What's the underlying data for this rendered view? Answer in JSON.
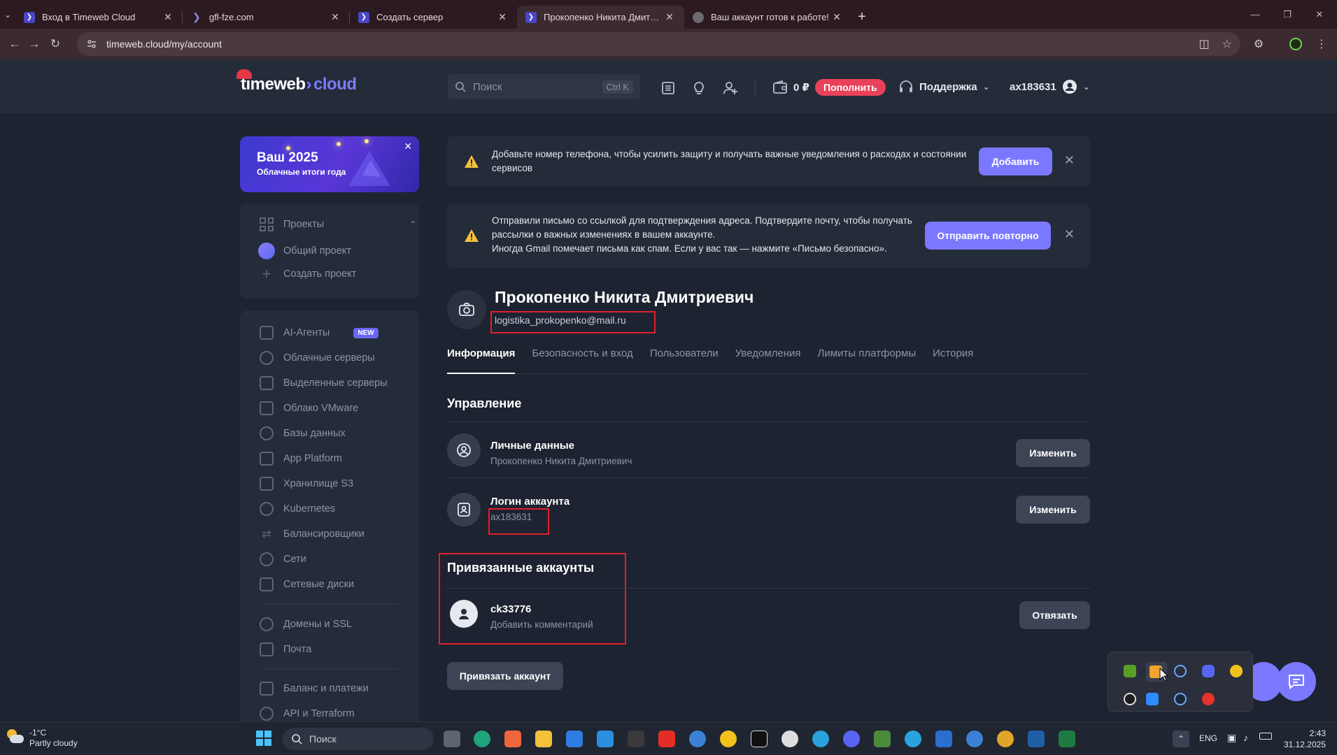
{
  "browser": {
    "tabs": [
      {
        "title": "Вход в Timeweb Cloud",
        "active": false
      },
      {
        "title": "gfl-fze.com",
        "active": false
      },
      {
        "title": "Создать сервер",
        "active": false
      },
      {
        "title": "Прокопенко Никита Дмитриевич",
        "active": true
      },
      {
        "title": "Ваш аккаунт готов к работе!",
        "active": false
      }
    ],
    "url": "timeweb.cloud/my/account"
  },
  "header": {
    "logo_main": "timeweb",
    "logo_accent": "cloud",
    "search_placeholder": "Поиск",
    "search_shortcut": "Ctrl K",
    "balance": "0 ₽",
    "topup_label": "Пополнить",
    "support_label": "Поддержка",
    "account_login": "ax183631"
  },
  "sidebar": {
    "promo_title": "Ваш 2025",
    "promo_subtitle": "Облачные итоги года",
    "projects_title": "Проекты",
    "projects": [
      "Общий проект",
      "Создать проект"
    ],
    "services": [
      {
        "label": "AI-Агенты",
        "badge": "NEW"
      },
      {
        "label": "Облачные серверы"
      },
      {
        "label": "Выделенные серверы"
      },
      {
        "label": "Облако VMware"
      },
      {
        "label": "Базы данных"
      },
      {
        "label": "App Platform"
      },
      {
        "label": "Хранилище S3"
      },
      {
        "label": "Kubernetes"
      },
      {
        "label": "Балансировщики"
      },
      {
        "label": "Сети"
      },
      {
        "label": "Сетевые диски"
      }
    ],
    "extras": [
      "Домены и SSL",
      "Почта"
    ],
    "billing": [
      "Баланс и платежи",
      "API и Terraform"
    ]
  },
  "alerts": [
    {
      "text": "Добавьте номер телефона, чтобы усилить защиту и получать важные уведомления о расходах и состоянии сервисов",
      "button": "Добавить"
    },
    {
      "text_lines": [
        "Отправили письмо со ссылкой для подтверждения адреса. Подтвердите почту, чтобы получать",
        "рассылки о важных изменениях в вашем аккаунте.",
        "Иногда Gmail помечает письма как спам. Если у вас так — нажмите «Письмо безопасно»."
      ],
      "button": "Отправить повторно"
    }
  ],
  "profile": {
    "name": "Прокопенко Никита Дмитриевич",
    "email": "logistika_prokopenko@mail.ru"
  },
  "tabs": [
    "Информация",
    "Безопасность и вход",
    "Пользователи",
    "Уведомления",
    "Лимиты платформы",
    "История"
  ],
  "management": {
    "title": "Управление",
    "rows": [
      {
        "name": "Личные данные",
        "value": "Прокопенко Никита Дмитриевич",
        "button": "Изменить"
      },
      {
        "name": "Логин аккаунта",
        "value": "ax183631",
        "button": "Изменить"
      }
    ]
  },
  "linked": {
    "title": "Привязанные аккаунты",
    "accounts": [
      {
        "name": "ck33776",
        "comment": "Добавить комментарий",
        "button": "Отвязать"
      }
    ],
    "link_button": "Привязать аккаунт"
  },
  "taskbar": {
    "weather_temp": "-1°C",
    "weather_desc": "Partly cloudy",
    "search_placeholder": "Поиск",
    "language": "ENG",
    "time": "2:43",
    "date": "31.12.2025"
  },
  "colors": {
    "accent": "#7b78ff",
    "danger": "#e9415a",
    "highlight_box": "#e0202a"
  }
}
